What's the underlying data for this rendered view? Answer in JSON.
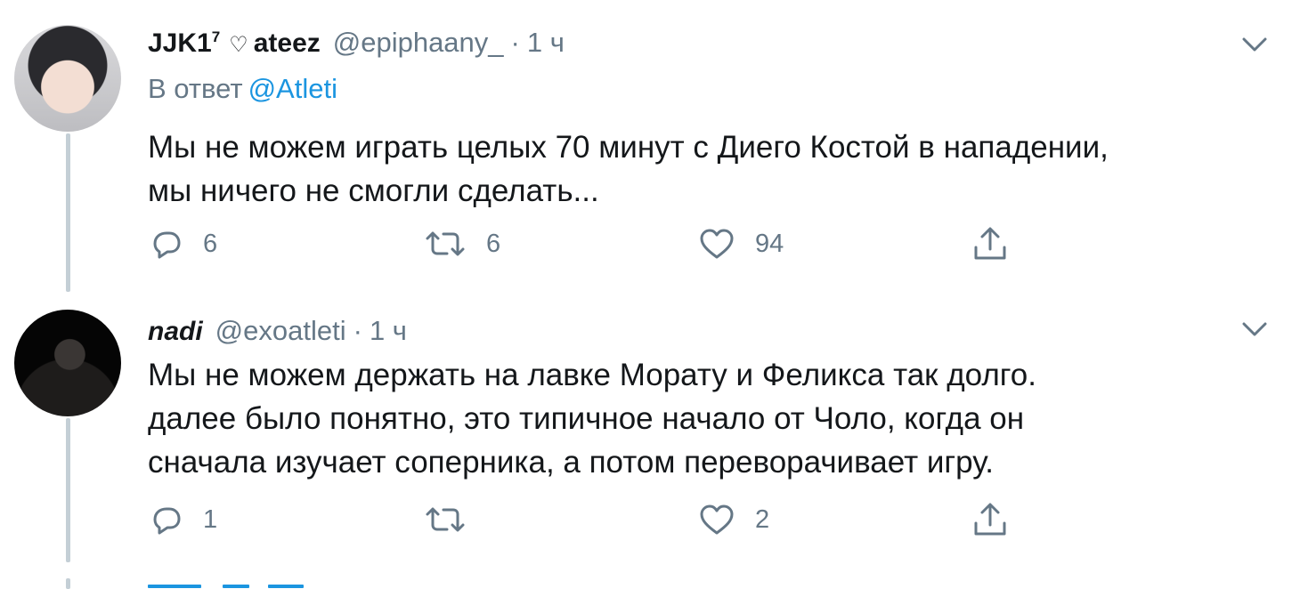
{
  "tweets": [
    {
      "display_name": "JJK1",
      "display_name_sup": "7",
      "heart": "♡",
      "display_name_suffix": "ateez",
      "handle": "@epiphaany_",
      "separator": "·",
      "time": "1 ч",
      "reply_prefix": "В ответ",
      "reply_mention": "@Atleti",
      "text": "Мы не можем играть целых 70 минут с Диего Костой в нападении,\nмы ничего не смогли сделать...",
      "replies": "6",
      "retweets": "6",
      "likes": "94"
    },
    {
      "display_name": "nadi",
      "handle": "@exoatleti",
      "separator": "·",
      "time": "1 ч",
      "text": "Мы не можем держать на лавке Морату и Феликса так долго.\nдалее было понятно, это типичное начало от Чоло, когда он\nсначала изучает соперника, а потом переворачивает игру.",
      "replies": "1",
      "retweets": "",
      "likes": "2"
    }
  ],
  "icons": {
    "reply": "reply-icon",
    "retweet": "retweet-icon",
    "like": "heart-icon",
    "share": "share-icon",
    "menu": "chevron-down-icon"
  },
  "colors": {
    "text": "#14171a",
    "secondary": "#657786",
    "link": "#1b95e0",
    "thread_line": "#c4cfd6"
  }
}
